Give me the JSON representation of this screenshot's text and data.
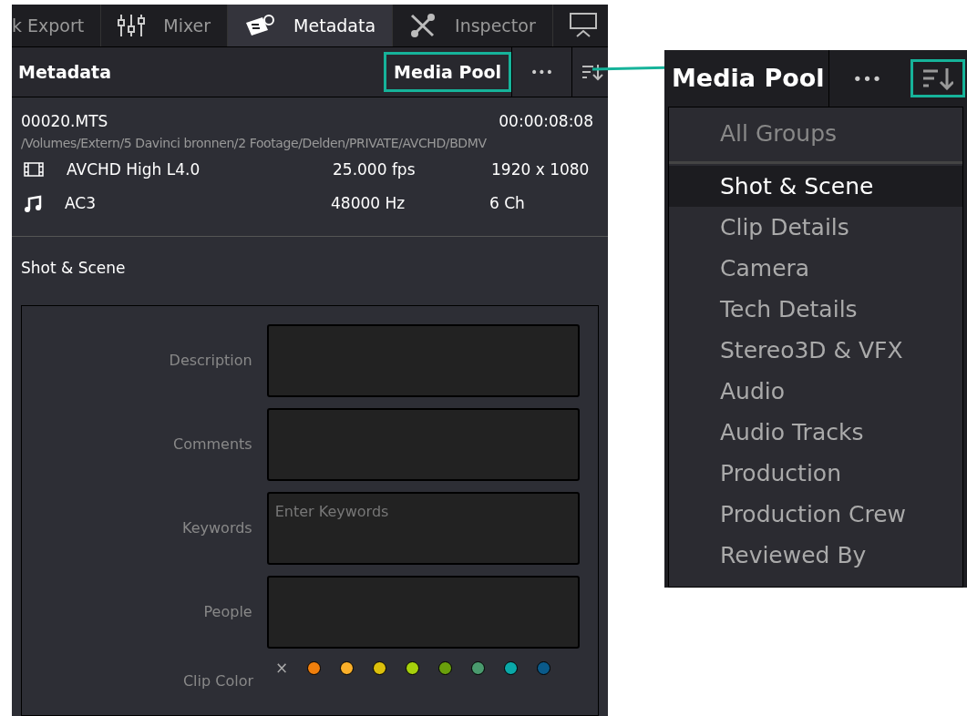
{
  "tabs": [
    {
      "label": "k Export",
      "selected": false
    },
    {
      "label": "Mixer",
      "selected": false
    },
    {
      "label": "Metadata",
      "selected": true
    },
    {
      "label": "Inspector",
      "selected": false
    },
    {
      "selected": false
    }
  ],
  "header": {
    "title": "Metadata",
    "source_button": "Media Pool",
    "more": "•••"
  },
  "clip": {
    "name": "00020.MTS",
    "duration": "00:00:08:08",
    "path": "/Volumes/Extern/5 Davinci bronnen/2 Footage/Delden/PRIVATE/AVCHD/BDMV",
    "streams": [
      {
        "kind": "video",
        "codec": "AVCHD High L4.0",
        "rate": "25.000 fps",
        "format": "1920 x 1080"
      },
      {
        "kind": "audio",
        "codec": "AC3",
        "rate": "48000 Hz",
        "format": "6 Ch"
      }
    ]
  },
  "section_title": "Shot & Scene",
  "fields": [
    {
      "label": "Description"
    },
    {
      "label": "Comments"
    },
    {
      "label": "Keywords",
      "placeholder": "Enter Keywords"
    },
    {
      "label": "People"
    }
  ],
  "clip_color": {
    "label": "Clip Color",
    "clear": "×",
    "colors": [
      {
        "color": "#f07f0c"
      },
      {
        "color": "#fbb02a"
      },
      {
        "color": "#dcc00c"
      },
      {
        "color": "#a6d10c"
      },
      {
        "color": "#6aa00c"
      },
      {
        "color": "#4a9a6e"
      },
      {
        "color": "#0aa8a8"
      },
      {
        "color": "#0a5a8a"
      }
    ]
  },
  "zoom_inset": {
    "source_button": "Media Pool",
    "more": "•••",
    "all_groups": "All Groups",
    "groups": [
      {
        "label": "Shot & Scene",
        "selected": true
      },
      {
        "label": "Clip Details",
        "selected": false
      },
      {
        "label": "Camera",
        "selected": false
      },
      {
        "label": "Tech Details",
        "selected": false
      },
      {
        "label": "Stereo3D & VFX",
        "selected": false
      },
      {
        "label": "Audio",
        "selected": false
      },
      {
        "label": "Audio Tracks",
        "selected": false
      },
      {
        "label": "Production",
        "selected": false
      },
      {
        "label": "Production Crew",
        "selected": false
      },
      {
        "label": "Reviewed By",
        "selected": false
      }
    ]
  }
}
